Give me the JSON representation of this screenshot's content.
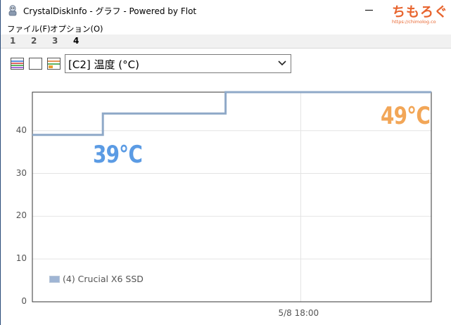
{
  "window": {
    "title": "CrystalDiskInfo - グラフ - Powered by Flot"
  },
  "watermark": {
    "text": "ちもろぐ",
    "url": "https://chimolog.co"
  },
  "menu": {
    "file": "ファイル(F)",
    "options": "オプション(O)"
  },
  "tabs": [
    "1",
    "2",
    "3",
    "4"
  ],
  "active_tab": "4",
  "toolbar": {
    "icons": [
      "chart-all-icon",
      "chart-blank-icon",
      "chart-toggle-icon"
    ]
  },
  "attribute_select": {
    "value": "[C2] 温度 (°C)"
  },
  "annotations": {
    "low": "39℃",
    "high": "49℃"
  },
  "colors": {
    "series_line": "#8fa9c8",
    "low_label": "#5b9be4",
    "high_label": "#f2a657",
    "watermark": "#e8652f"
  },
  "chart_data": {
    "type": "line",
    "title": "",
    "xlabel": "",
    "ylabel": "",
    "ylim": [
      0,
      49
    ],
    "yticks": [
      0,
      10,
      20,
      30,
      40
    ],
    "xticks": [
      "5/8 18:00"
    ],
    "grid": true,
    "legend_position": "bottom-left",
    "x_range": [
      "5/8 09:26",
      "5/8 22:10"
    ],
    "series": [
      {
        "name": "(4) Crucial X6 SSD",
        "points": [
          {
            "x": "5/8 09:26",
            "y": 39
          },
          {
            "x": "5/8 11:41",
            "y": 39
          },
          {
            "x": "5/8 11:41",
            "y": 44
          },
          {
            "x": "5/8 15:36",
            "y": 44
          },
          {
            "x": "5/8 15:36",
            "y": 49
          },
          {
            "x": "5/8 22:10",
            "y": 49
          }
        ]
      }
    ]
  }
}
